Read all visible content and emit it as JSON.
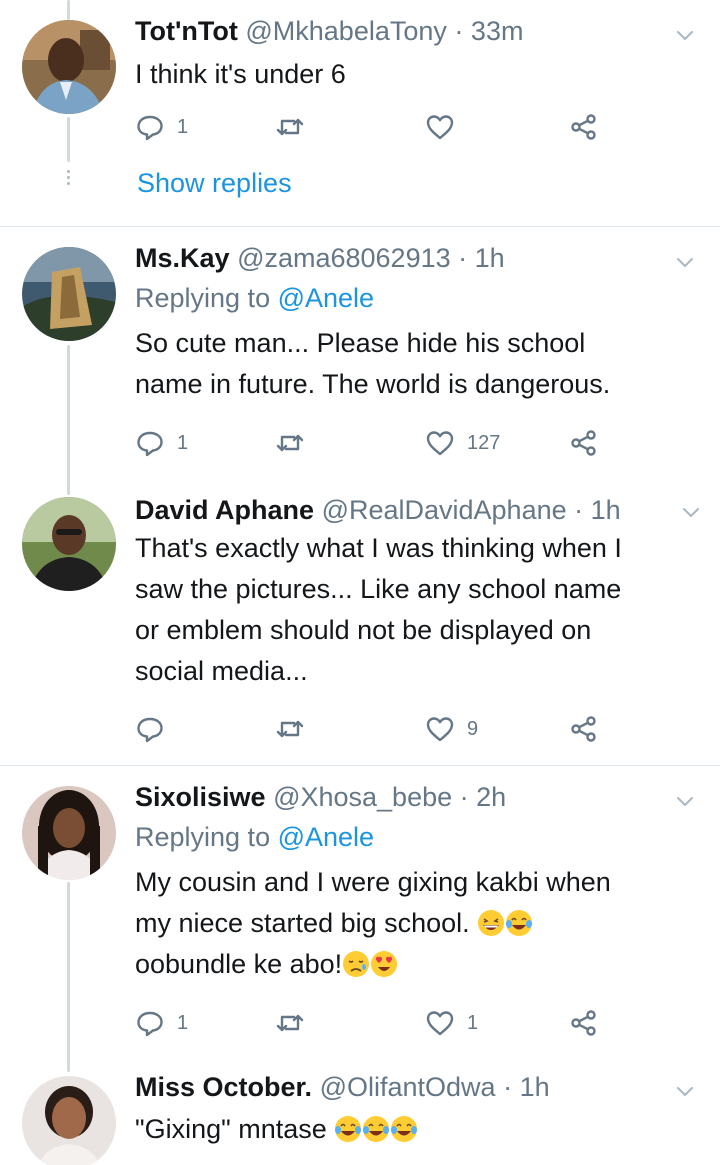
{
  "tweets": [
    {
      "name": "Tot'nTot",
      "handle": "@MkhabelaTony",
      "sep": "·",
      "time": "33m",
      "reply_prefix": "",
      "reply_mention": "",
      "lines": [
        "I think it's under 6"
      ],
      "reply_count": "1",
      "retweet_count": "",
      "like_count": "",
      "show_replies": "Show replies"
    },
    {
      "name": "Ms.Kay",
      "handle": "@zama68062913",
      "sep": "·",
      "time": "1h",
      "reply_prefix": "Replying to ",
      "reply_mention": "@Anele",
      "lines": [
        "So cute man... Please hide his school",
        "name in future. The world is dangerous."
      ],
      "reply_count": "1",
      "retweet_count": "",
      "like_count": "127"
    },
    {
      "name": "David Aphane",
      "handle": "@RealDavidAphane",
      "sep": "·",
      "time": "1h",
      "lines": [
        "That's exactly what I was thinking when I",
        "saw the pictures... Like any school name",
        "or emblem should not be displayed on",
        "social media..."
      ],
      "reply_count": "",
      "retweet_count": "",
      "like_count": "9"
    },
    {
      "name": "Sixolisiwe",
      "handle": "@Xhosa_bebe",
      "sep": "·",
      "time": "2h",
      "reply_prefix": "Replying to ",
      "reply_mention": "@Anele",
      "lines": [
        "My cousin and I were gixing kakbi when",
        "my niece started big school.",
        "oobundle ke abo!"
      ],
      "reply_count": "1",
      "retweet_count": "",
      "like_count": "1"
    },
    {
      "name": "Miss October.",
      "handle": "@OlifantOdwa",
      "sep": "·",
      "time": "1h",
      "lines": [
        "\"Gixing\" mntase"
      ]
    }
  ],
  "colors": {
    "text": "#14171a",
    "secondary": "#657786",
    "link": "#1b95e0",
    "icon": "#657786",
    "divider": "#e1e8ed"
  },
  "icons": {
    "reply": "comment-bubble-icon",
    "retweet": "retweet-icon",
    "like": "heart-icon",
    "share": "share-icon",
    "more": "chevron-down-icon",
    "emoji_grin": "grinning-squinting-face-emoji",
    "emoji_laugh": "tears-of-joy-emoji",
    "emoji_sad": "sad-relieved-face-emoji",
    "emoji_love": "heart-eyes-emoji"
  }
}
